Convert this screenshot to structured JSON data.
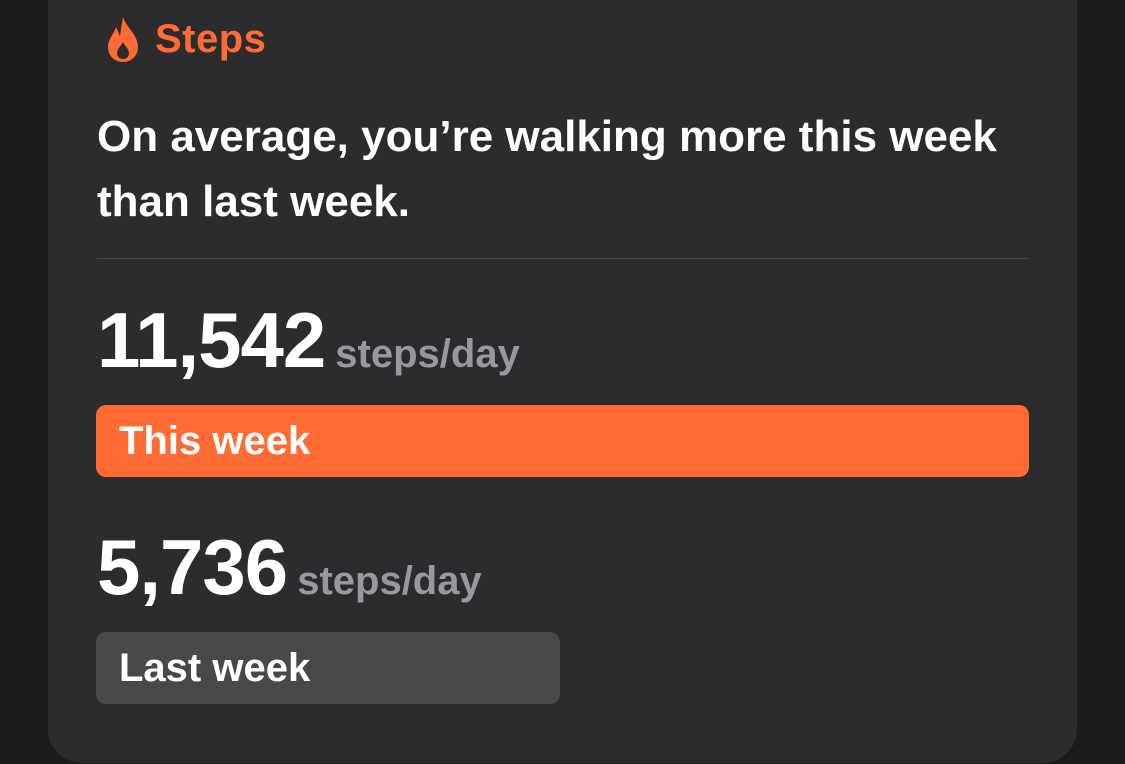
{
  "card": {
    "title": "Steps",
    "icon": "flame-icon",
    "accent_color": "#ff6b35",
    "headline": "On average, you’re walking more this week than last week."
  },
  "comparison": {
    "unit": "steps/day",
    "this_week": {
      "value": "11,542",
      "steps_per_day": 11542,
      "label": "This week",
      "bar_color": "#ff6b35"
    },
    "last_week": {
      "value": "5,736",
      "steps_per_day": 5736,
      "label": "Last week",
      "bar_color": "#48484a"
    }
  }
}
